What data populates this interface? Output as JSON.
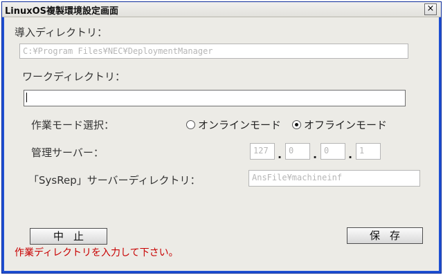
{
  "window": {
    "title": "LinuxOS複製環境設定画面",
    "close_label": "×"
  },
  "install_dir": {
    "label": "導入ディレクトリ：",
    "value": "C:¥Program Files¥NEC¥DeploymentManager"
  },
  "work_dir": {
    "label": "ワークディレクトリ：",
    "value": ""
  },
  "mode": {
    "label": "作業モード選択：",
    "options": [
      {
        "label": "オンラインモード",
        "selected": false
      },
      {
        "label": "オフラインモード",
        "selected": true
      }
    ]
  },
  "server": {
    "label": "管理サーバー：",
    "ip": [
      "127",
      "0",
      "0",
      "1"
    ],
    "separator": "."
  },
  "sysrep": {
    "label": "「SysRep」サーバーディレクトリ：",
    "value": "AnsFile¥machineinf"
  },
  "buttons": {
    "cancel": "中止",
    "save": "保存"
  },
  "status": {
    "message": "作業ディレクトリを入力して下さい。",
    "color": "#c80000"
  },
  "colors": {
    "frame": "#1e4fd2",
    "client": "#ecebe6"
  }
}
